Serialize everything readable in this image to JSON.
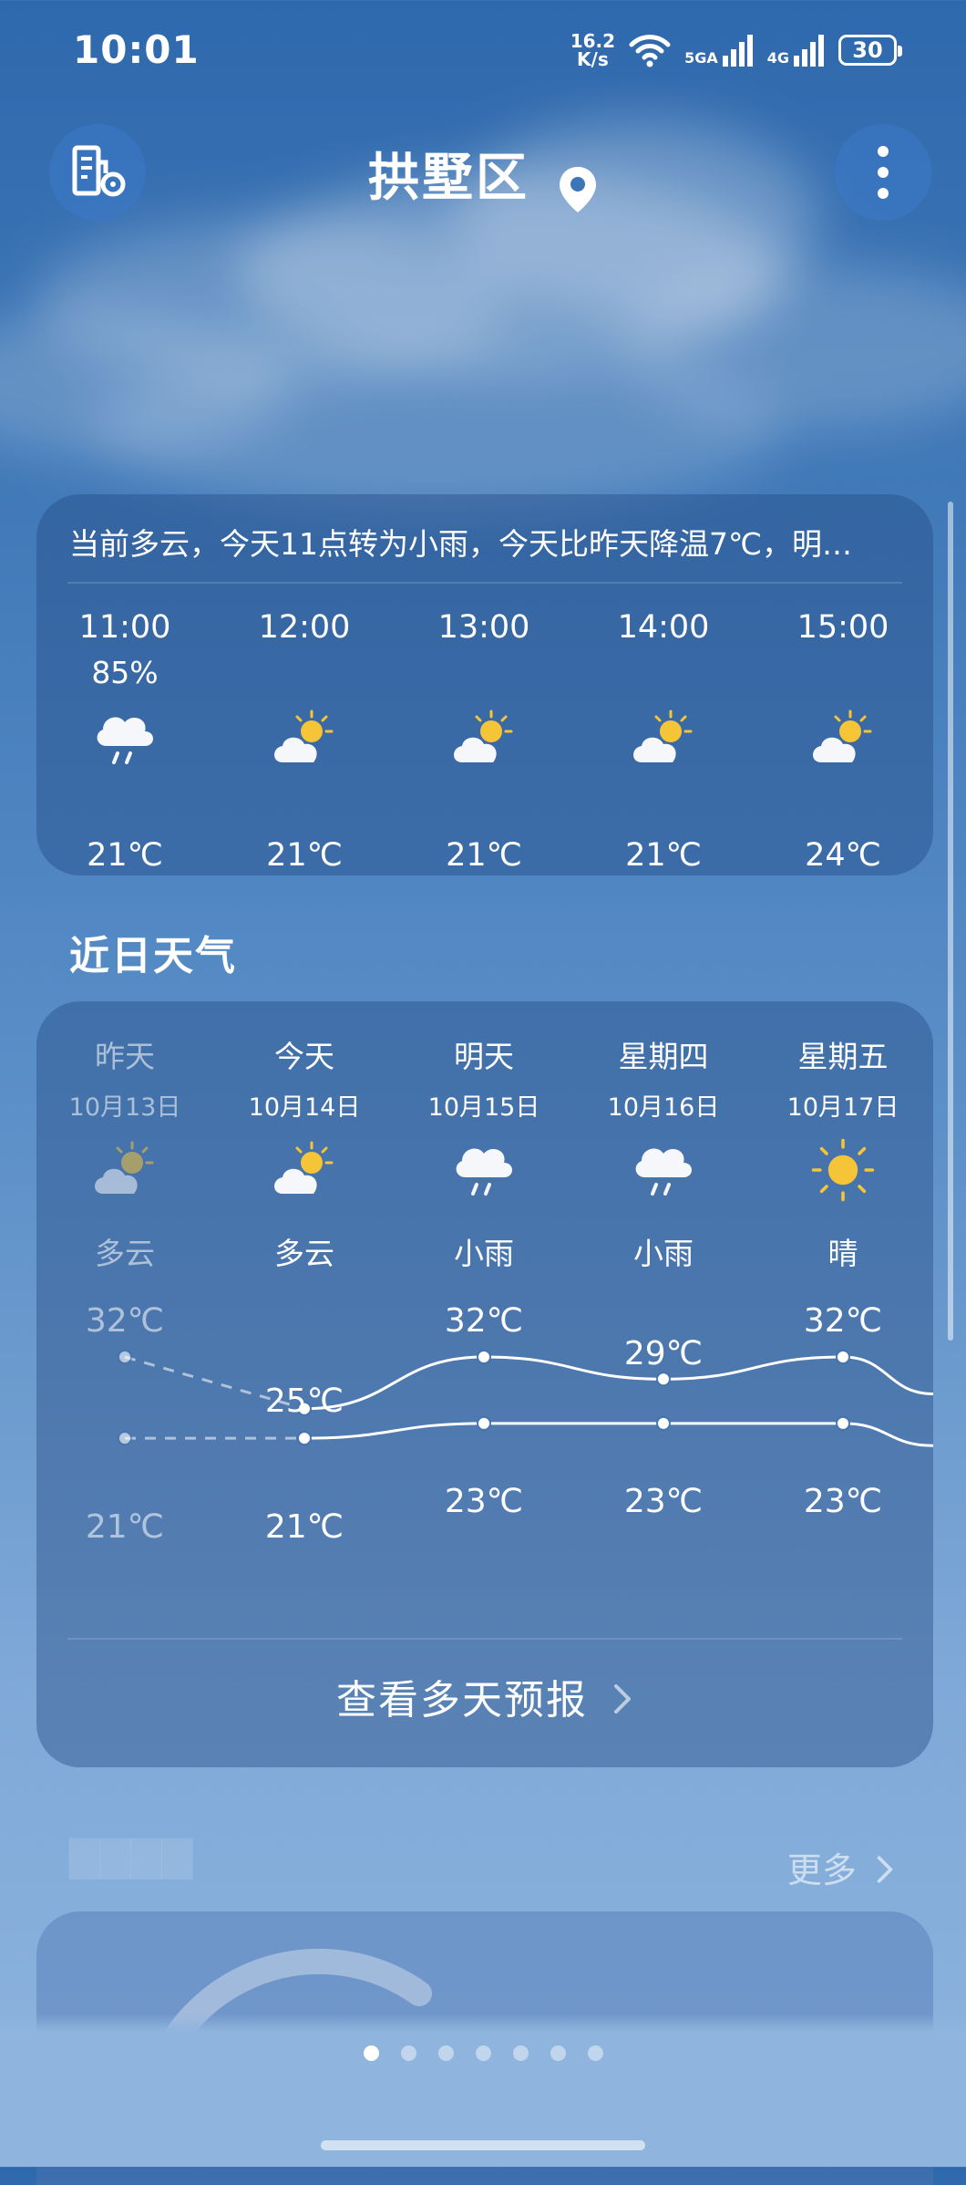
{
  "status_bar": {
    "time": "10:01",
    "net_speed_value": "16.2",
    "net_speed_unit": "K/s",
    "net_5g": "5GA",
    "net_4g": "4G",
    "battery": "30",
    "icons": [
      "wifi-icon",
      "signal-5g-icon",
      "signal-4g-icon",
      "battery-icon"
    ]
  },
  "header": {
    "title": "拱墅区",
    "left_button_icon": "city-settings-icon",
    "right_button_icon": "more-vertical-icon",
    "location_icon": "location-pin-icon"
  },
  "hourly": {
    "summary": "当前多云，今天11点转为小雨，今天比昨天降温7℃，明…",
    "hours": [
      {
        "time": "11:00",
        "precip": "85%",
        "icon": "rain-icon",
        "temp": "21℃"
      },
      {
        "time": "12:00",
        "precip": "",
        "icon": "partly-cloudy-icon",
        "temp": "21℃"
      },
      {
        "time": "13:00",
        "precip": "",
        "icon": "partly-cloudy-icon",
        "temp": "21℃"
      },
      {
        "time": "14:00",
        "precip": "",
        "icon": "partly-cloudy-icon",
        "temp": "21℃"
      },
      {
        "time": "15:00",
        "precip": "",
        "icon": "partly-cloudy-icon",
        "temp": "24℃"
      }
    ]
  },
  "recent": {
    "section_title": "近日天气",
    "days": [
      {
        "name": "昨天",
        "date": "10月13日",
        "icon": "partly-cloudy-icon",
        "condition": "多云",
        "high": "32℃",
        "low": "21℃",
        "high_value": 32,
        "low_value": 21
      },
      {
        "name": "今天",
        "date": "10月14日",
        "icon": "partly-cloudy-icon",
        "condition": "多云",
        "high": "25℃",
        "low": "21℃",
        "high_value": 25,
        "low_value": 21
      },
      {
        "name": "明天",
        "date": "10月15日",
        "icon": "rain-icon",
        "condition": "小雨",
        "high": "32℃",
        "low": "23℃",
        "high_value": 32,
        "low_value": 23
      },
      {
        "name": "星期四",
        "date": "10月16日",
        "icon": "rain-icon",
        "condition": "小雨",
        "high": "29℃",
        "low": "23℃",
        "high_value": 29,
        "low_value": 23
      },
      {
        "name": "星期五",
        "date": "10月17日",
        "icon": "sunny-icon",
        "condition": "晴",
        "high": "32℃",
        "low": "23℃",
        "high_value": 32,
        "low_value": 23
      }
    ],
    "view_more_label": "查看多天预报",
    "view_more_icon": "chevron-right-icon"
  },
  "next_section": {
    "more_label": "更多",
    "more_icon": "chevron-right-icon"
  },
  "pagination": {
    "total": 7,
    "active": 0
  },
  "colors": {
    "bg_top": "#2f69ad",
    "bg_bottom": "#8fb4de",
    "card": "rgba(35,75,130,0.42)",
    "sun": "#f6c437"
  }
}
